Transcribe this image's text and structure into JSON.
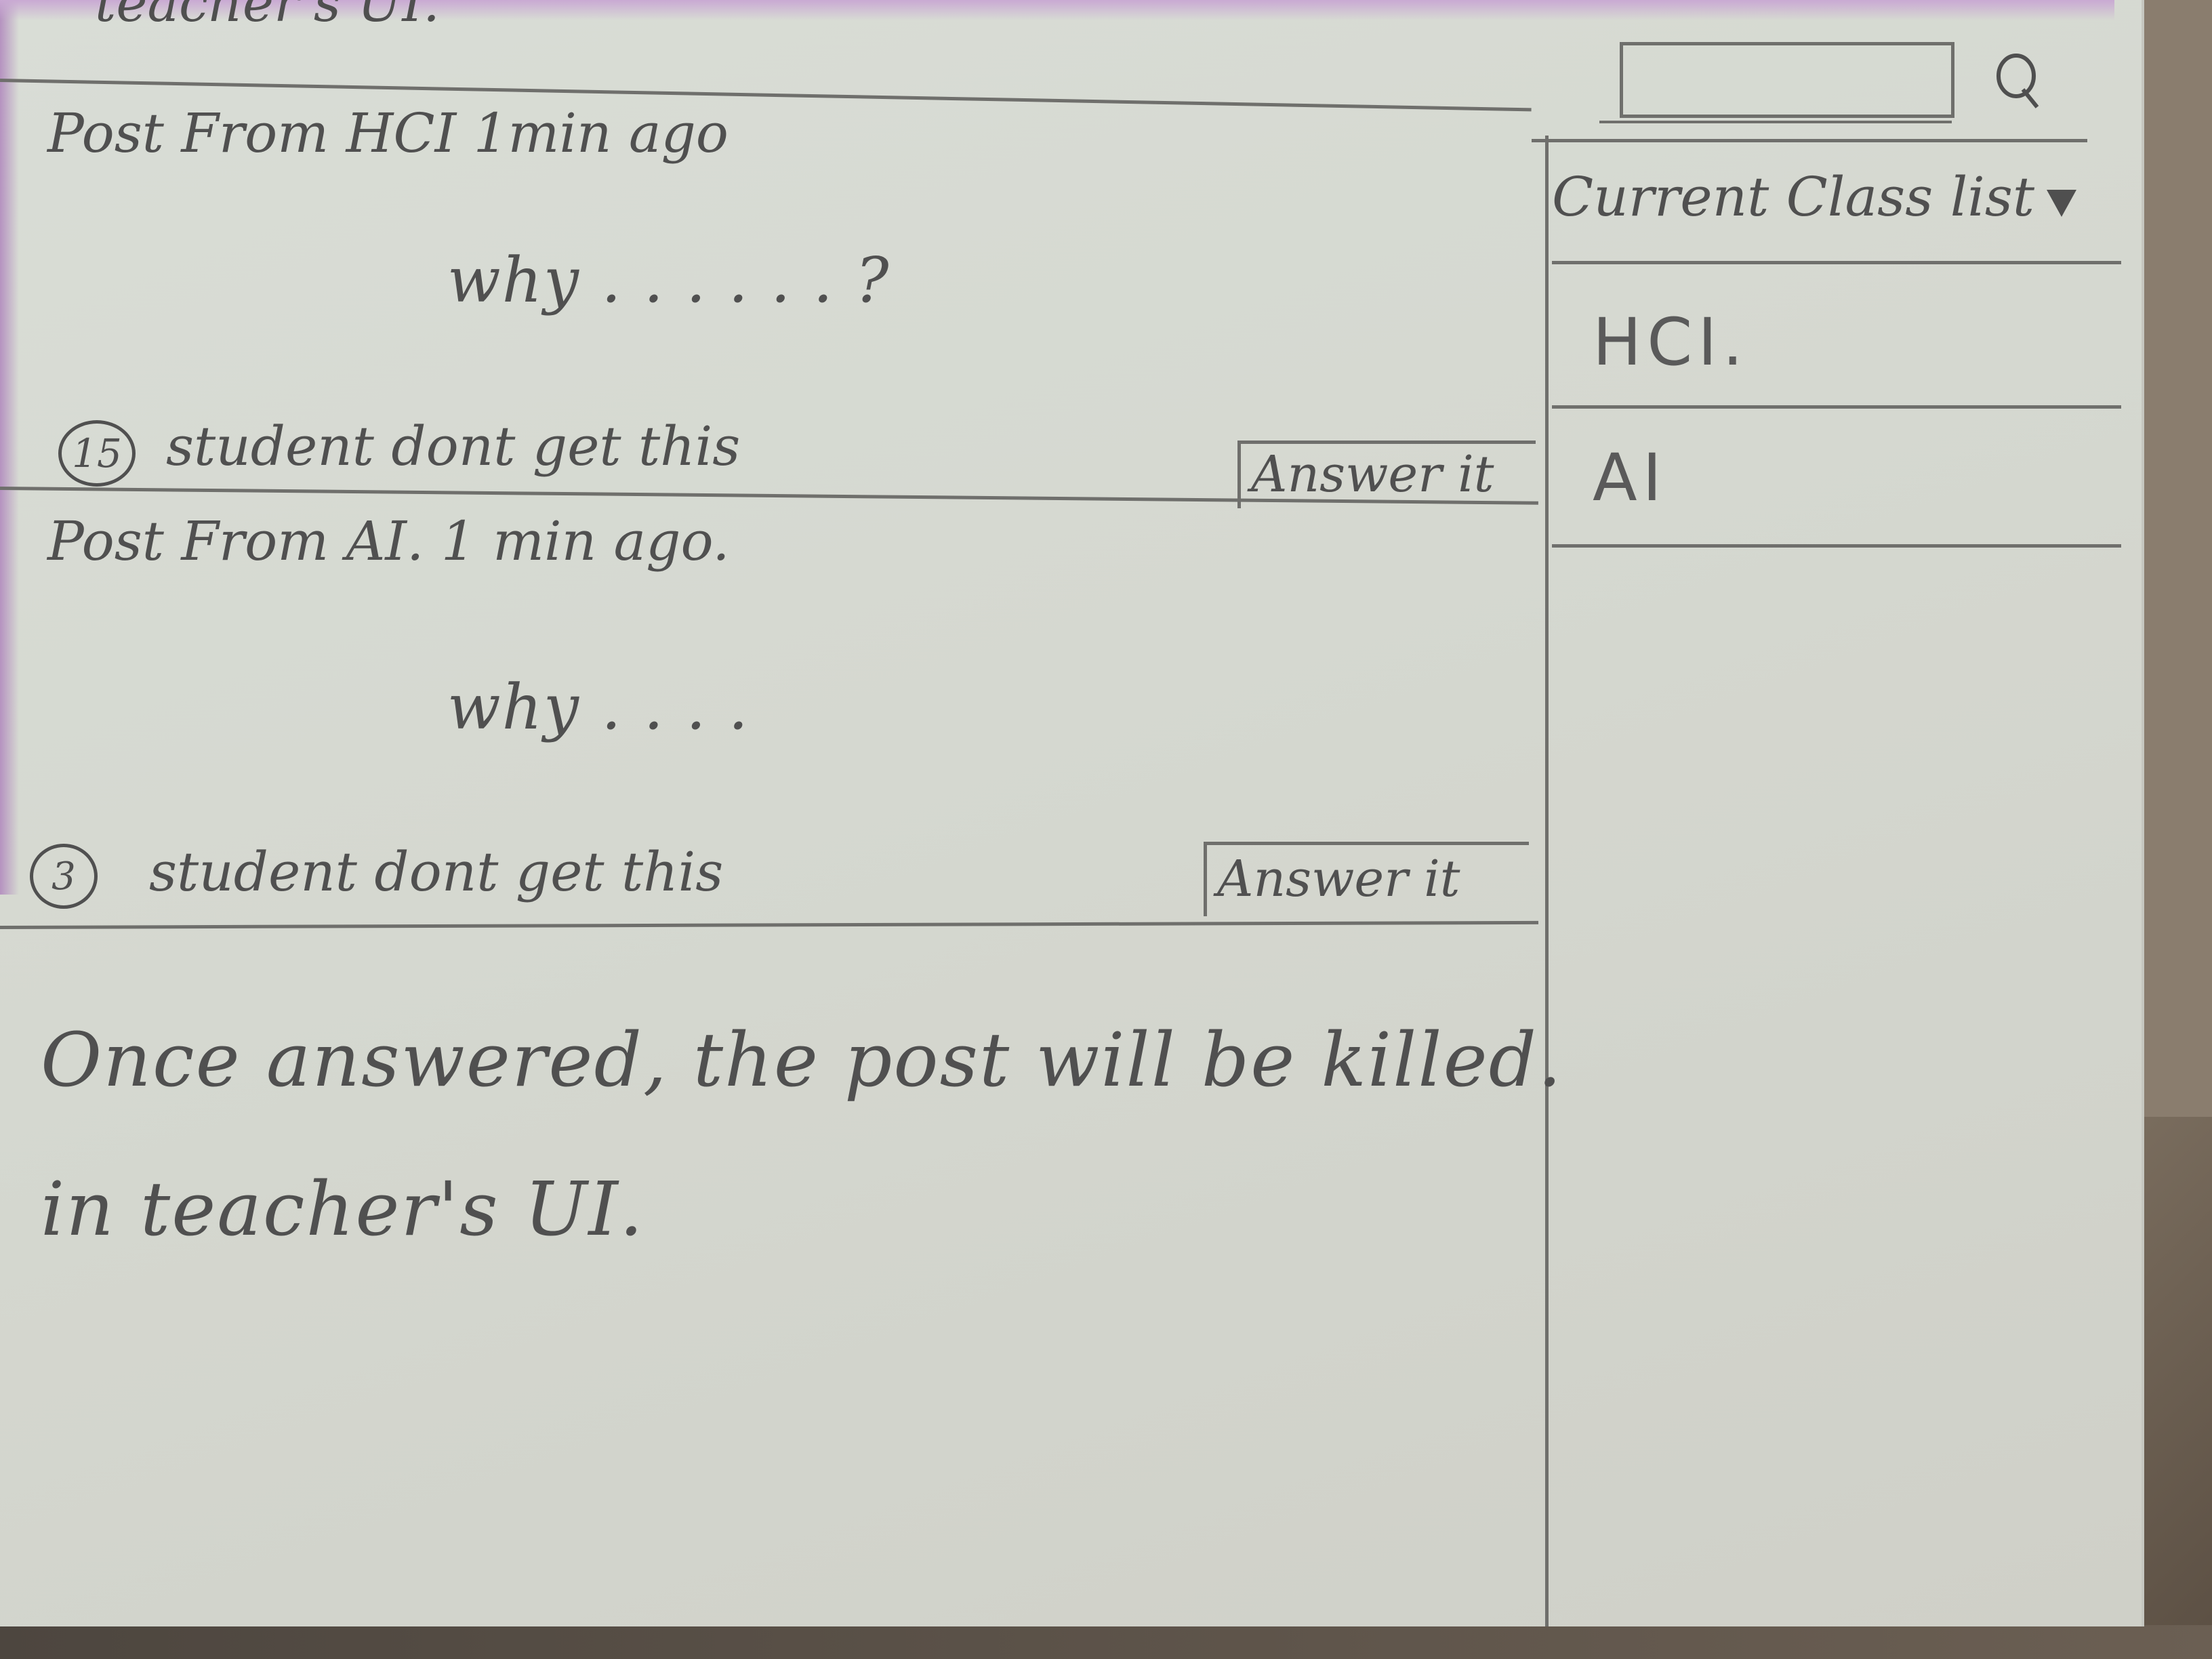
{
  "app": {
    "title_partial": "teacher's UI."
  },
  "search": {
    "value": "",
    "placeholder": ""
  },
  "posts": [
    {
      "header": "Post From HCI 1min ago",
      "question": "why . . . . . . ?",
      "confused_count": "15",
      "confused_text": "student dont get this",
      "answer_label": "Answer it"
    },
    {
      "header": "Post From AI. 1 min ago.",
      "question": "why . . . .",
      "confused_count": "3",
      "confused_text": "student dont get this",
      "answer_label": "Answer it"
    }
  ],
  "note": {
    "line1": "Once answered, the post will be killed.",
    "line2": "in teacher's UI."
  },
  "sidebar": {
    "dropdown_label": "Current Class list",
    "classes": [
      {
        "label": "HCI."
      },
      {
        "label": "AI"
      }
    ]
  },
  "icons": {
    "search": "search-icon",
    "dropdown": "triangle-down-icon"
  }
}
